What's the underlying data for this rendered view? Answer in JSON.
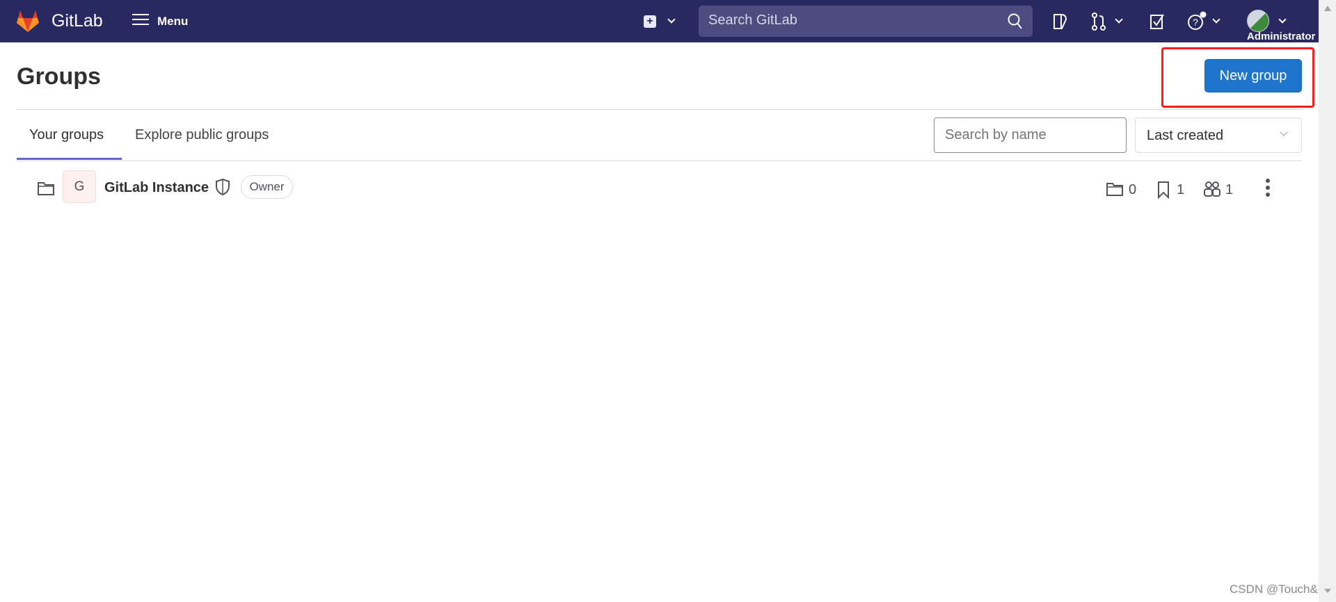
{
  "header": {
    "brand": "GitLab",
    "menu_label": "Menu",
    "search_placeholder": "Search GitLab",
    "user_label": "Administrator",
    "icons": [
      "gitlab-logo",
      "hamburger-icon",
      "plus-square-icon",
      "search-icon",
      "issues-icon",
      "merge-request-icon",
      "todo-icon",
      "help-icon",
      "avatar"
    ],
    "color": "#292961"
  },
  "page": {
    "title": "Groups",
    "new_group_label": "New group",
    "accent": "#1f75cb"
  },
  "tabs": [
    {
      "label": "Your groups",
      "active": true
    },
    {
      "label": "Explore public groups",
      "active": false
    }
  ],
  "filter": {
    "search_placeholder": "Search by name",
    "sort_value": "Last created"
  },
  "groups": [
    {
      "avatar_letter": "G",
      "name": "GitLab Instance",
      "role": "Owner",
      "subgroups": "0",
      "projects": "1",
      "members": "1"
    }
  ],
  "watermark": "CSDN @Touch&"
}
